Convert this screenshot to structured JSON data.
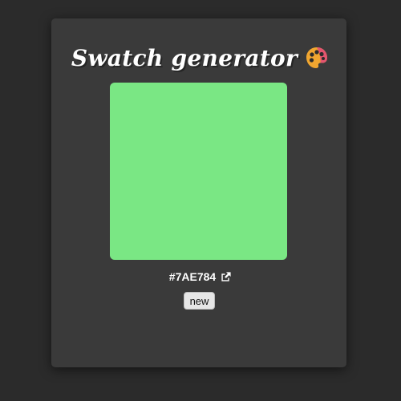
{
  "app": {
    "title": "Swatch generator"
  },
  "swatch": {
    "color": "#7AE784",
    "hex_label": "#7AE784"
  },
  "icons": {
    "title_icon": "artist-palette-icon",
    "link_icon": "external-link-icon"
  },
  "actions": {
    "new_label": "new"
  },
  "colors": {
    "page_background": "#2b2b2b",
    "card_background": "#3a3a3a",
    "text": "#ffffff"
  }
}
